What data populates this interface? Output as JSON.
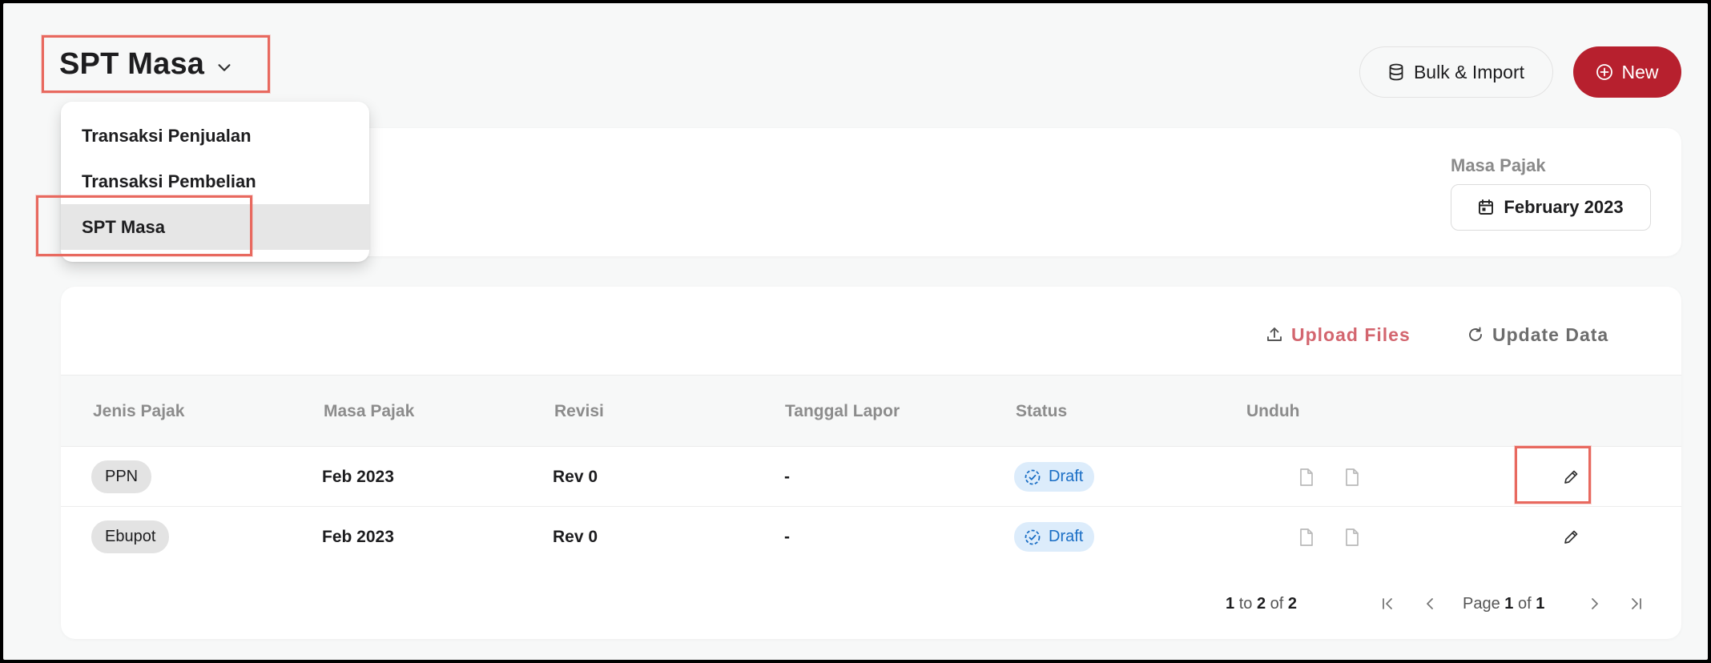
{
  "header": {
    "title": "SPT Masa",
    "bulk_import_label": "Bulk & Import",
    "new_label": "New"
  },
  "dropdown": {
    "items": [
      {
        "label": "Transaksi Penjualan"
      },
      {
        "label": "Transaksi Pembelian"
      },
      {
        "label": "SPT Masa",
        "active": true
      }
    ]
  },
  "filter": {
    "masa_pajak_label": "Masa Pajak",
    "masa_pajak_value": "February 2023"
  },
  "table": {
    "actions": {
      "upload_label": "Upload Files",
      "update_label": "Update Data"
    },
    "columns": [
      "Jenis Pajak",
      "Masa Pajak",
      "Revisi",
      "Tanggal Lapor",
      "Status",
      "Unduh"
    ],
    "rows": [
      {
        "jenis": "PPN",
        "masa": "Feb 2023",
        "revisi": "Rev 0",
        "tanggal": "-",
        "status": "Draft"
      },
      {
        "jenis": "Ebupot",
        "masa": "Feb 2023",
        "revisi": "Rev 0",
        "tanggal": "-",
        "status": "Draft"
      }
    ],
    "pagination": {
      "from": "1",
      "to_word": "to",
      "to": "2",
      "of_word": "of",
      "total": "2",
      "page_word": "Page",
      "page": "1",
      "page_of_word": "of",
      "page_total": "1"
    }
  },
  "colors": {
    "primary": "#b7202e",
    "upload": "#d3666f",
    "status_bg": "#dcecfb",
    "status_text": "#1a6ec5",
    "highlight": "#e8695f"
  },
  "icons": {
    "title_dropdown": "chevron-down-icon",
    "bulk_import": "database-icon",
    "new": "plus-circle-icon",
    "date": "calendar-icon",
    "upload": "upload-icon",
    "update": "refresh-icon",
    "status": "draft-status-icon",
    "download": "file-icon",
    "edit": "pencil-icon",
    "first_page": "first-page-icon",
    "prev_page": "chevron-left-icon",
    "next_page": "chevron-right-icon",
    "last_page": "last-page-icon"
  }
}
